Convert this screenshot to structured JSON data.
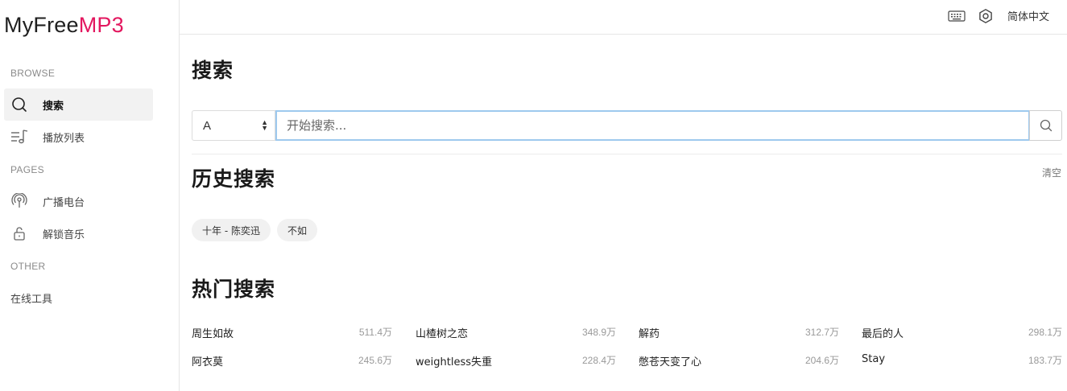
{
  "logo": {
    "part1": "MyFree",
    "part2": "MP3"
  },
  "sidebar": {
    "sections": [
      "BROWSE",
      "PAGES",
      "OTHER"
    ],
    "items": [
      {
        "label": "搜索",
        "icon": "search-icon",
        "active": true
      },
      {
        "label": "播放列表",
        "icon": "playlist-icon",
        "active": false
      },
      {
        "label": "广播电台",
        "icon": "radio-icon",
        "active": false
      },
      {
        "label": "解锁音乐",
        "icon": "unlock-icon",
        "active": false
      }
    ],
    "other_link": "在线工具"
  },
  "header": {
    "keyboard_icon": "keyboard-icon",
    "settings_icon": "settings-icon",
    "language": "简体中文"
  },
  "search": {
    "title": "搜索",
    "source_selected": "A",
    "placeholder": "开始搜索..."
  },
  "history": {
    "title": "历史搜索",
    "clear_label": "清空",
    "chips": [
      "十年 - 陈奕迅",
      "不如"
    ]
  },
  "hot": {
    "title": "热门搜索",
    "columns": [
      [
        {
          "title": "周生如故",
          "count": "511.4万"
        },
        {
          "title": "阿衣莫",
          "count": "245.6万"
        }
      ],
      [
        {
          "title": "山楂树之恋",
          "count": "348.9万"
        },
        {
          "title": "weightless失重",
          "count": "228.4万"
        }
      ],
      [
        {
          "title": "解药",
          "count": "312.7万"
        },
        {
          "title": "憋苍天变了心",
          "count": "204.6万"
        }
      ],
      [
        {
          "title": "最后的人",
          "count": "298.1万"
        },
        {
          "title": "Stay",
          "count": "183.7万"
        }
      ]
    ]
  },
  "colors": {
    "accent": "#e3175f",
    "input_focus": "#9ec9ee"
  }
}
